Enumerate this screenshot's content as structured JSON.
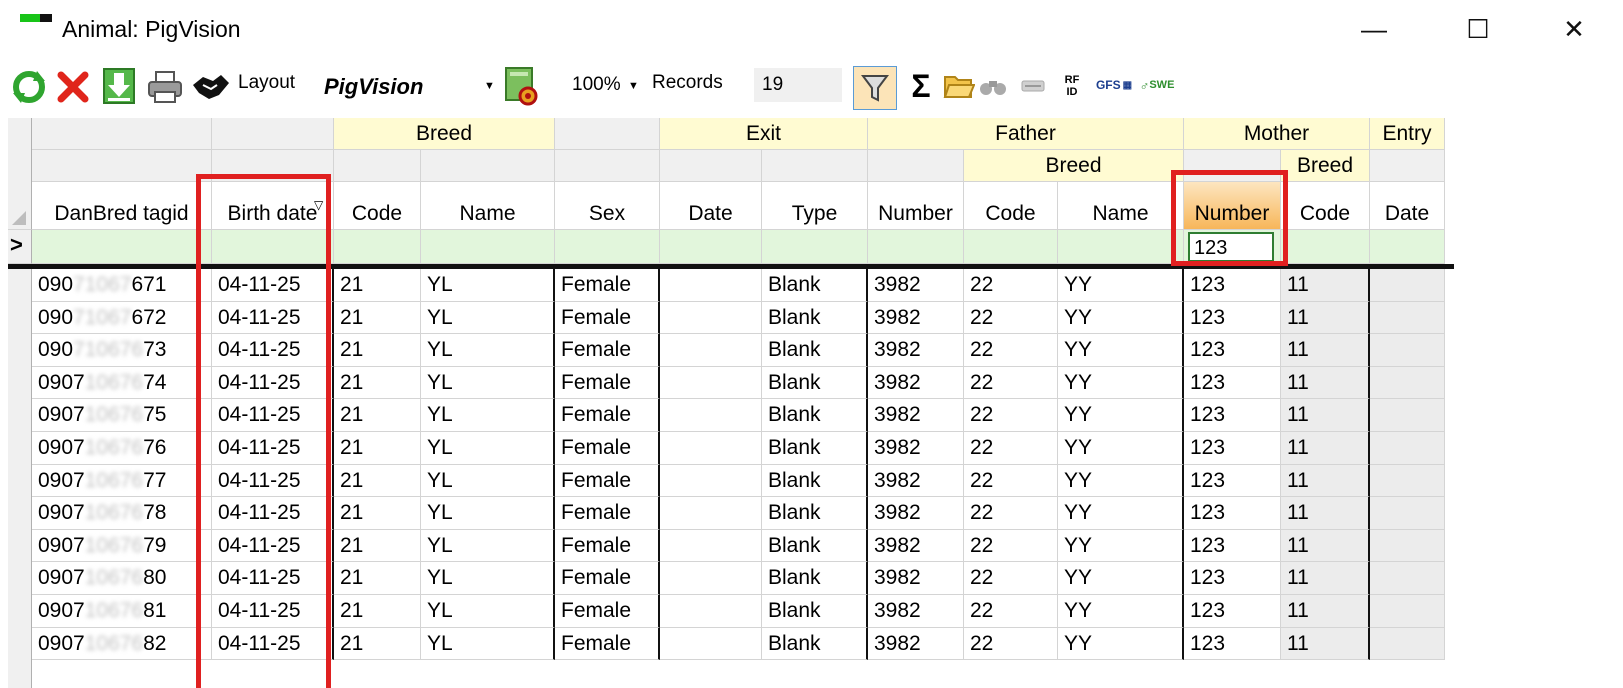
{
  "window": {
    "title": "Animal: PigVision",
    "minimize_glyph": "—",
    "maximize_glyph": "☐",
    "close_glyph": "✕"
  },
  "toolbar": {
    "layout_label": "Layout",
    "layout_value": "PigVision",
    "zoom_value": "100%",
    "records_label": "Records",
    "records_value": "19",
    "sum_glyph": "Σ",
    "rfid_label": "RF ID",
    "gfs_label": "GFS",
    "swe_label": "SWE",
    "icons": [
      "refresh-icon",
      "delete-icon",
      "download-icon",
      "print-icon",
      "handshake-icon",
      "layout-settings-icon",
      "filter-icon",
      "sum-icon",
      "open-folder-icon",
      "binoculars-icon",
      "scanner-icon",
      "rfid-icon",
      "gfs-icon",
      "swe-icon"
    ]
  },
  "grid": {
    "groups_row1": [
      {
        "key": "breed",
        "label": "Breed"
      },
      {
        "key": "exit",
        "label": "Exit"
      },
      {
        "key": "father",
        "label": "Father"
      },
      {
        "key": "mother",
        "label": "Mother"
      },
      {
        "key": "entry",
        "label": "Entry"
      }
    ],
    "groups_row2": [
      {
        "key": "father_breed",
        "label": "Breed"
      },
      {
        "key": "mother_breed",
        "label": "Breed"
      }
    ],
    "columns": [
      "DanBred tagid",
      "Birth date",
      "Code",
      "Name",
      "Sex",
      "Date",
      "Type",
      "Number",
      "Code",
      "Name",
      "Number",
      "Code",
      "Date"
    ],
    "filter_row": {
      "indicator": ">",
      "mother_number": "123"
    },
    "rows": [
      {
        "tag_prefix": "090",
        "tag_mid": "71067",
        "tag_suffix": "671",
        "birth": "04-11-25",
        "breed_code": "21",
        "breed_name": "YL",
        "sex": "Female",
        "exit_date": "",
        "exit_type": "Blank",
        "father_number": "3982",
        "father_code": "22",
        "father_name": "YY",
        "mother_number": "123",
        "mother_code": "11",
        "entry_date": ""
      },
      {
        "tag_prefix": "090",
        "tag_mid": "71067",
        "tag_suffix": "672",
        "birth": "04-11-25",
        "breed_code": "21",
        "breed_name": "YL",
        "sex": "Female",
        "exit_date": "",
        "exit_type": "Blank",
        "father_number": "3982",
        "father_code": "22",
        "father_name": "YY",
        "mother_number": "123",
        "mother_code": "11",
        "entry_date": ""
      },
      {
        "tag_prefix": "090",
        "tag_mid": "710676",
        "tag_suffix": "73",
        "birth": "04-11-25",
        "breed_code": "21",
        "breed_name": "YL",
        "sex": "Female",
        "exit_date": "",
        "exit_type": "Blank",
        "father_number": "3982",
        "father_code": "22",
        "father_name": "YY",
        "mother_number": "123",
        "mother_code": "11",
        "entry_date": ""
      },
      {
        "tag_prefix": "0907",
        "tag_mid": "10676",
        "tag_suffix": "74",
        "birth": "04-11-25",
        "breed_code": "21",
        "breed_name": "YL",
        "sex": "Female",
        "exit_date": "",
        "exit_type": "Blank",
        "father_number": "3982",
        "father_code": "22",
        "father_name": "YY",
        "mother_number": "123",
        "mother_code": "11",
        "entry_date": ""
      },
      {
        "tag_prefix": "0907",
        "tag_mid": "10676",
        "tag_suffix": "75",
        "birth": "04-11-25",
        "breed_code": "21",
        "breed_name": "YL",
        "sex": "Female",
        "exit_date": "",
        "exit_type": "Blank",
        "father_number": "3982",
        "father_code": "22",
        "father_name": "YY",
        "mother_number": "123",
        "mother_code": "11",
        "entry_date": ""
      },
      {
        "tag_prefix": "0907",
        "tag_mid": "10676",
        "tag_suffix": "76",
        "birth": "04-11-25",
        "breed_code": "21",
        "breed_name": "YL",
        "sex": "Female",
        "exit_date": "",
        "exit_type": "Blank",
        "father_number": "3982",
        "father_code": "22",
        "father_name": "YY",
        "mother_number": "123",
        "mother_code": "11",
        "entry_date": ""
      },
      {
        "tag_prefix": "0907",
        "tag_mid": "10676",
        "tag_suffix": "77",
        "birth": "04-11-25",
        "breed_code": "21",
        "breed_name": "YL",
        "sex": "Female",
        "exit_date": "",
        "exit_type": "Blank",
        "father_number": "3982",
        "father_code": "22",
        "father_name": "YY",
        "mother_number": "123",
        "mother_code": "11",
        "entry_date": ""
      },
      {
        "tag_prefix": "0907",
        "tag_mid": "10676",
        "tag_suffix": "78",
        "birth": "04-11-25",
        "breed_code": "21",
        "breed_name": "YL",
        "sex": "Female",
        "exit_date": "",
        "exit_type": "Blank",
        "father_number": "3982",
        "father_code": "22",
        "father_name": "YY",
        "mother_number": "123",
        "mother_code": "11",
        "entry_date": ""
      },
      {
        "tag_prefix": "0907",
        "tag_mid": "10676",
        "tag_suffix": "79",
        "birth": "04-11-25",
        "breed_code": "21",
        "breed_name": "YL",
        "sex": "Female",
        "exit_date": "",
        "exit_type": "Blank",
        "father_number": "3982",
        "father_code": "22",
        "father_name": "YY",
        "mother_number": "123",
        "mother_code": "11",
        "entry_date": ""
      },
      {
        "tag_prefix": "0907",
        "tag_mid": "10676",
        "tag_suffix": "80",
        "birth": "04-11-25",
        "breed_code": "21",
        "breed_name": "YL",
        "sex": "Female",
        "exit_date": "",
        "exit_type": "Blank",
        "father_number": "3982",
        "father_code": "22",
        "father_name": "YY",
        "mother_number": "123",
        "mother_code": "11",
        "entry_date": ""
      },
      {
        "tag_prefix": "0907",
        "tag_mid": "10676",
        "tag_suffix": "81",
        "birth": "04-11-25",
        "breed_code": "21",
        "breed_name": "YL",
        "sex": "Female",
        "exit_date": "",
        "exit_type": "Blank",
        "father_number": "3982",
        "father_code": "22",
        "father_name": "YY",
        "mother_number": "123",
        "mother_code": "11",
        "entry_date": ""
      },
      {
        "tag_prefix": "0907",
        "tag_mid": "10676",
        "tag_suffix": "82",
        "birth": "04-11-25",
        "breed_code": "21",
        "breed_name": "YL",
        "sex": "Female",
        "exit_date": "",
        "exit_type": "Blank",
        "father_number": "3982",
        "father_code": "22",
        "father_name": "YY",
        "mother_number": "123",
        "mother_code": "11",
        "entry_date": ""
      }
    ]
  },
  "colors": {
    "group_header": "#fffbd2",
    "filter_row": "#e2f6dc",
    "selected_header": "#f7b65a",
    "highlight": "#e02020",
    "filter_edit_border": "#2e7d32",
    "inactive_column": "#ececec"
  }
}
